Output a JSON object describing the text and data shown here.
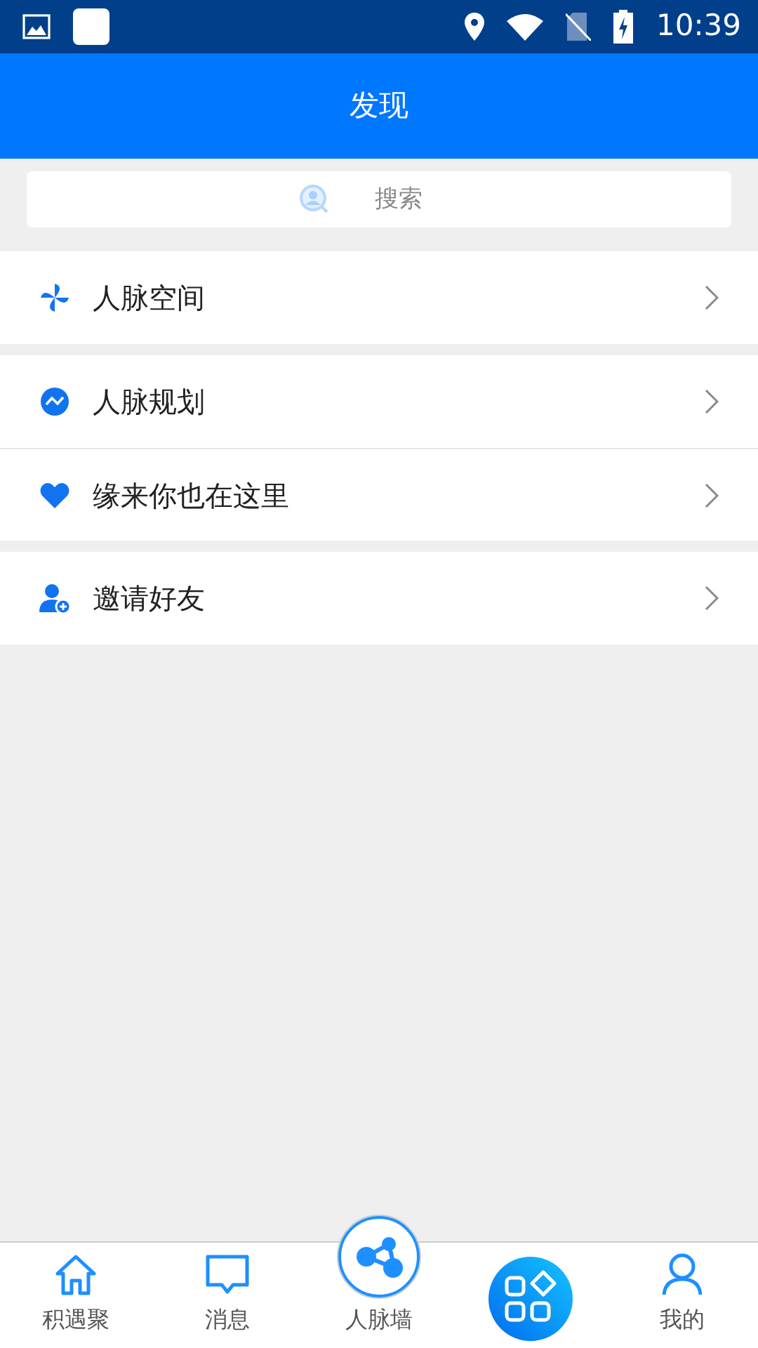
{
  "status_bar": {
    "time": "10:39"
  },
  "header": {
    "title": "发现"
  },
  "search": {
    "placeholder": "搜索"
  },
  "groups": [
    {
      "items": [
        {
          "kind": "pinwheel",
          "label": "人脉空间"
        }
      ]
    },
    {
      "items": [
        {
          "kind": "trend",
          "label": "人脉规划"
        },
        {
          "kind": "heart",
          "label": "缘来你也在这里"
        }
      ]
    },
    {
      "items": [
        {
          "kind": "invite",
          "label": "邀请好友"
        }
      ]
    }
  ],
  "tab_bar": [
    {
      "kind": "home",
      "label": "积遇聚",
      "selected": false
    },
    {
      "kind": "message",
      "label": "消息",
      "selected": false
    },
    {
      "kind": "network",
      "label": "人脉墙",
      "selected": false
    },
    {
      "kind": "apps",
      "selected": true
    },
    {
      "kind": "profile",
      "label": "我的",
      "selected": false
    }
  ]
}
